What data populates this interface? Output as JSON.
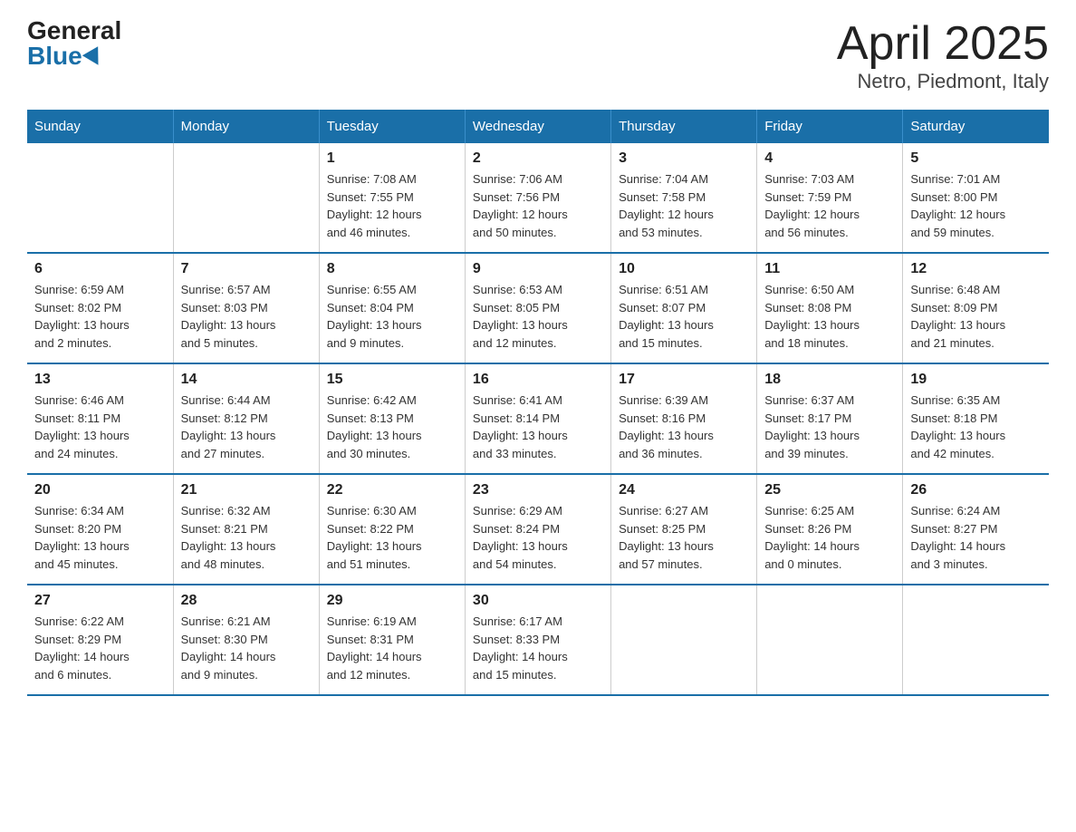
{
  "logo": {
    "general": "General",
    "blue": "Blue"
  },
  "title": "April 2025",
  "subtitle": "Netro, Piedmont, Italy",
  "days_of_week": [
    "Sunday",
    "Monday",
    "Tuesday",
    "Wednesday",
    "Thursday",
    "Friday",
    "Saturday"
  ],
  "weeks": [
    [
      {
        "num": "",
        "detail": ""
      },
      {
        "num": "",
        "detail": ""
      },
      {
        "num": "1",
        "detail": "Sunrise: 7:08 AM\nSunset: 7:55 PM\nDaylight: 12 hours\nand 46 minutes."
      },
      {
        "num": "2",
        "detail": "Sunrise: 7:06 AM\nSunset: 7:56 PM\nDaylight: 12 hours\nand 50 minutes."
      },
      {
        "num": "3",
        "detail": "Sunrise: 7:04 AM\nSunset: 7:58 PM\nDaylight: 12 hours\nand 53 minutes."
      },
      {
        "num": "4",
        "detail": "Sunrise: 7:03 AM\nSunset: 7:59 PM\nDaylight: 12 hours\nand 56 minutes."
      },
      {
        "num": "5",
        "detail": "Sunrise: 7:01 AM\nSunset: 8:00 PM\nDaylight: 12 hours\nand 59 minutes."
      }
    ],
    [
      {
        "num": "6",
        "detail": "Sunrise: 6:59 AM\nSunset: 8:02 PM\nDaylight: 13 hours\nand 2 minutes."
      },
      {
        "num": "7",
        "detail": "Sunrise: 6:57 AM\nSunset: 8:03 PM\nDaylight: 13 hours\nand 5 minutes."
      },
      {
        "num": "8",
        "detail": "Sunrise: 6:55 AM\nSunset: 8:04 PM\nDaylight: 13 hours\nand 9 minutes."
      },
      {
        "num": "9",
        "detail": "Sunrise: 6:53 AM\nSunset: 8:05 PM\nDaylight: 13 hours\nand 12 minutes."
      },
      {
        "num": "10",
        "detail": "Sunrise: 6:51 AM\nSunset: 8:07 PM\nDaylight: 13 hours\nand 15 minutes."
      },
      {
        "num": "11",
        "detail": "Sunrise: 6:50 AM\nSunset: 8:08 PM\nDaylight: 13 hours\nand 18 minutes."
      },
      {
        "num": "12",
        "detail": "Sunrise: 6:48 AM\nSunset: 8:09 PM\nDaylight: 13 hours\nand 21 minutes."
      }
    ],
    [
      {
        "num": "13",
        "detail": "Sunrise: 6:46 AM\nSunset: 8:11 PM\nDaylight: 13 hours\nand 24 minutes."
      },
      {
        "num": "14",
        "detail": "Sunrise: 6:44 AM\nSunset: 8:12 PM\nDaylight: 13 hours\nand 27 minutes."
      },
      {
        "num": "15",
        "detail": "Sunrise: 6:42 AM\nSunset: 8:13 PM\nDaylight: 13 hours\nand 30 minutes."
      },
      {
        "num": "16",
        "detail": "Sunrise: 6:41 AM\nSunset: 8:14 PM\nDaylight: 13 hours\nand 33 minutes."
      },
      {
        "num": "17",
        "detail": "Sunrise: 6:39 AM\nSunset: 8:16 PM\nDaylight: 13 hours\nand 36 minutes."
      },
      {
        "num": "18",
        "detail": "Sunrise: 6:37 AM\nSunset: 8:17 PM\nDaylight: 13 hours\nand 39 minutes."
      },
      {
        "num": "19",
        "detail": "Sunrise: 6:35 AM\nSunset: 8:18 PM\nDaylight: 13 hours\nand 42 minutes."
      }
    ],
    [
      {
        "num": "20",
        "detail": "Sunrise: 6:34 AM\nSunset: 8:20 PM\nDaylight: 13 hours\nand 45 minutes."
      },
      {
        "num": "21",
        "detail": "Sunrise: 6:32 AM\nSunset: 8:21 PM\nDaylight: 13 hours\nand 48 minutes."
      },
      {
        "num": "22",
        "detail": "Sunrise: 6:30 AM\nSunset: 8:22 PM\nDaylight: 13 hours\nand 51 minutes."
      },
      {
        "num": "23",
        "detail": "Sunrise: 6:29 AM\nSunset: 8:24 PM\nDaylight: 13 hours\nand 54 minutes."
      },
      {
        "num": "24",
        "detail": "Sunrise: 6:27 AM\nSunset: 8:25 PM\nDaylight: 13 hours\nand 57 minutes."
      },
      {
        "num": "25",
        "detail": "Sunrise: 6:25 AM\nSunset: 8:26 PM\nDaylight: 14 hours\nand 0 minutes."
      },
      {
        "num": "26",
        "detail": "Sunrise: 6:24 AM\nSunset: 8:27 PM\nDaylight: 14 hours\nand 3 minutes."
      }
    ],
    [
      {
        "num": "27",
        "detail": "Sunrise: 6:22 AM\nSunset: 8:29 PM\nDaylight: 14 hours\nand 6 minutes."
      },
      {
        "num": "28",
        "detail": "Sunrise: 6:21 AM\nSunset: 8:30 PM\nDaylight: 14 hours\nand 9 minutes."
      },
      {
        "num": "29",
        "detail": "Sunrise: 6:19 AM\nSunset: 8:31 PM\nDaylight: 14 hours\nand 12 minutes."
      },
      {
        "num": "30",
        "detail": "Sunrise: 6:17 AM\nSunset: 8:33 PM\nDaylight: 14 hours\nand 15 minutes."
      },
      {
        "num": "",
        "detail": ""
      },
      {
        "num": "",
        "detail": ""
      },
      {
        "num": "",
        "detail": ""
      }
    ]
  ]
}
